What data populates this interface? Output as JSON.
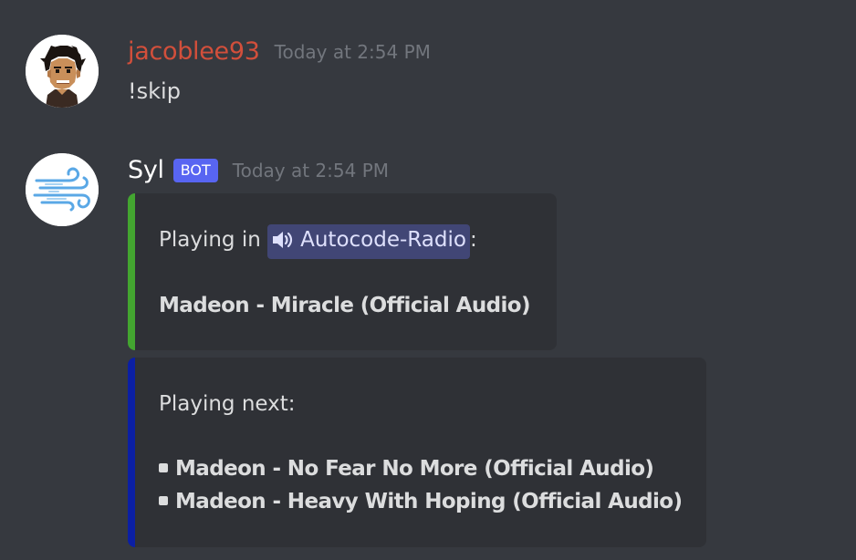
{
  "messages": [
    {
      "username": "jacoblee93",
      "timestamp": "Today at 2:54 PM",
      "text": "!skip",
      "avatar_icon": "pixel-person-avatar"
    },
    {
      "username": "Syl",
      "bot_tag": "BOT",
      "timestamp": "Today at 2:54 PM",
      "avatar_icon": "wind-avatar",
      "embeds": [
        {
          "accent_color": "#43a530",
          "prefix": "Playing in",
          "channel_icon": "speaker-icon",
          "channel_name": "Autocode-Radio",
          "suffix": ":",
          "title": "Madeon - Miracle (Official Audio)"
        },
        {
          "accent_color": "#0b1fa4",
          "heading": "Playing next:",
          "items": [
            "Madeon - No Fear No More (Official Audio)",
            "Madeon - Heavy With Hoping (Official Audio)"
          ]
        }
      ]
    }
  ]
}
